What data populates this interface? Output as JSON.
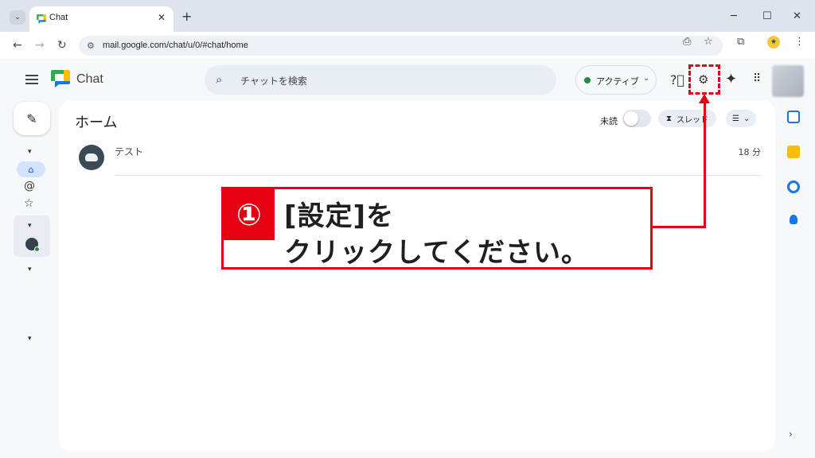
{
  "browser": {
    "tab_title": "Chat",
    "url": "mail.google.com/chat/u/0/#chat/home",
    "new_tab_glyph": "+",
    "close_glyph": "✕"
  },
  "app": {
    "name": "Chat",
    "search_placeholder": "チャットを検索",
    "status_label": "アクティブ",
    "home_title": "ホーム",
    "unread_label": "未読",
    "threads_label": "スレッド",
    "chats": [
      {
        "name": "テスト",
        "time": "18 分"
      }
    ]
  },
  "annotation": {
    "number": "①",
    "line1": "[設定]を",
    "line2": "クリックしてください。",
    "color": "#e60012"
  },
  "colors": {
    "accent": "#0b57d0",
    "active_status": "#1e8e3e",
    "highlight": "#e60012"
  }
}
